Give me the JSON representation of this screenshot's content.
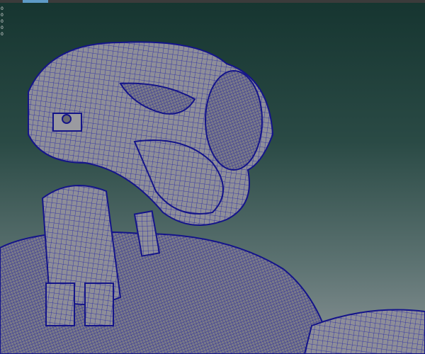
{
  "viewport": {
    "hud_values": [
      "0",
      "0",
      "0",
      "0",
      "0"
    ],
    "colors": {
      "wireframe": "#1e1ea8",
      "surface": "#8c8c94",
      "background_top": "#163530",
      "background_bottom": "#8a9396"
    }
  }
}
